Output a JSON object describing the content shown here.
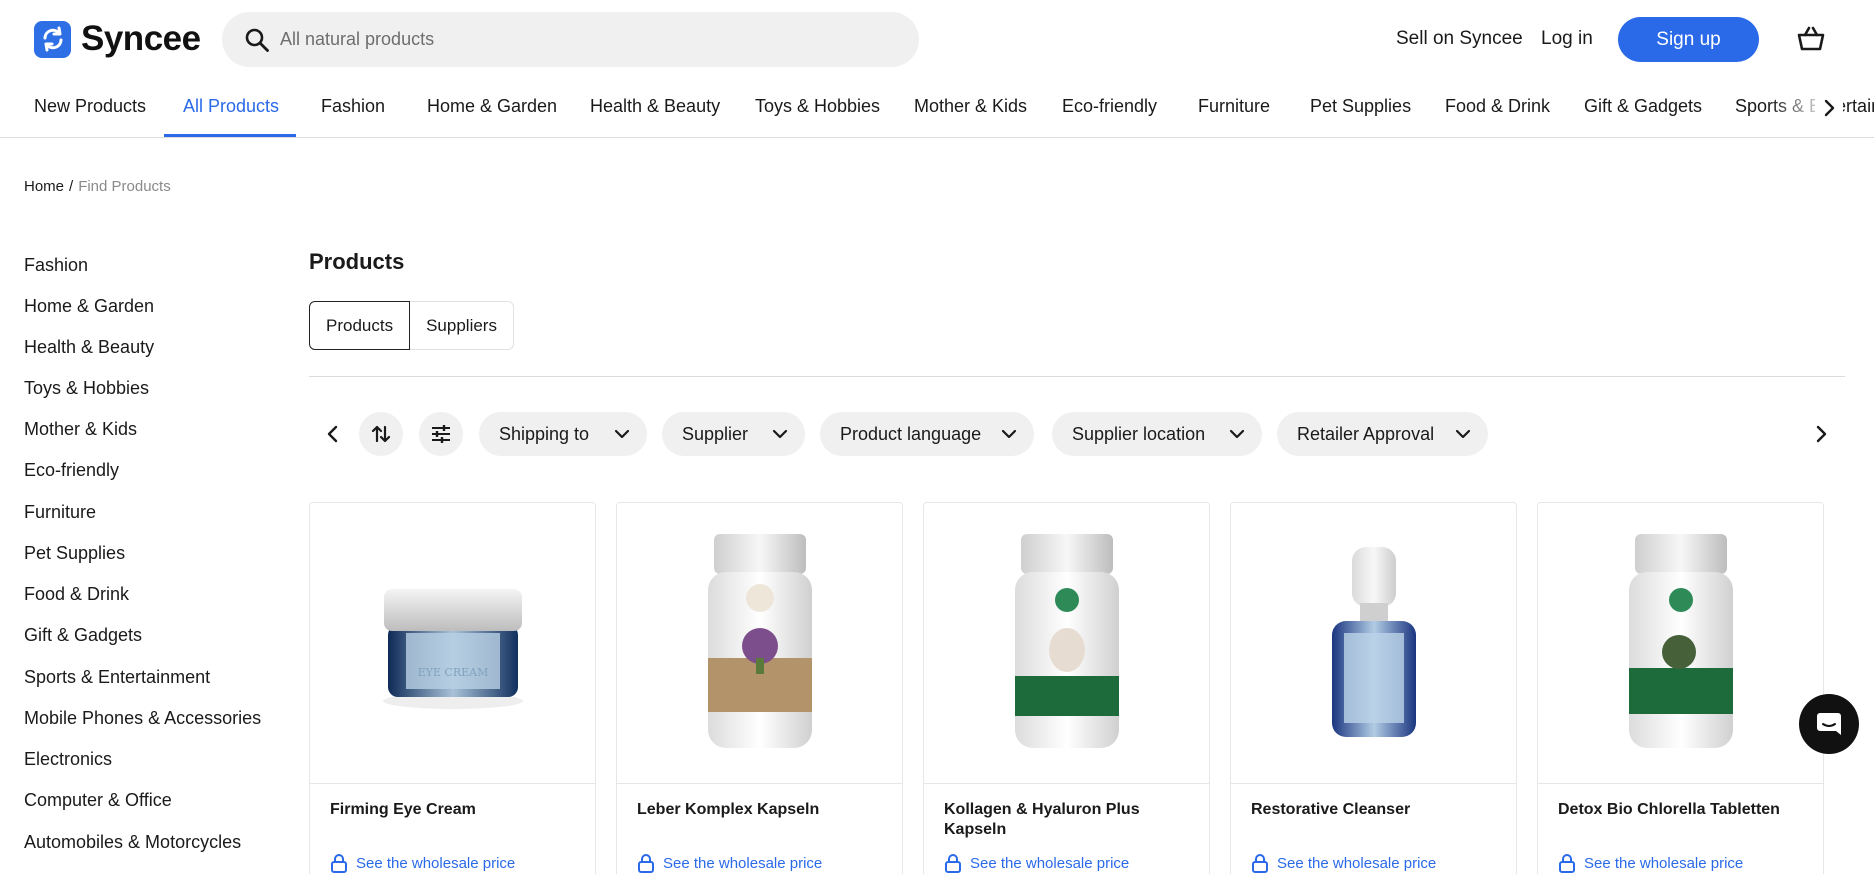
{
  "brand": {
    "name": "Syncee",
    "accent": "#2a6ae9"
  },
  "search": {
    "placeholder": "All natural products"
  },
  "header": {
    "sell": "Sell on Syncee",
    "login": "Log in",
    "signup": "Sign up",
    "cart_icon": "basket-icon"
  },
  "categories": [
    {
      "label": "New Products",
      "active": false
    },
    {
      "label": "All Products",
      "active": true
    },
    {
      "label": "Fashion",
      "active": false
    },
    {
      "label": "Home & Garden",
      "active": false
    },
    {
      "label": "Health & Beauty",
      "active": false
    },
    {
      "label": "Toys & Hobbies",
      "active": false
    },
    {
      "label": "Mother & Kids",
      "active": false
    },
    {
      "label": "Eco-friendly",
      "active": false
    },
    {
      "label": "Furniture",
      "active": false
    },
    {
      "label": "Pet Supplies",
      "active": false
    },
    {
      "label": "Food & Drink",
      "active": false
    },
    {
      "label": "Gift & Gadgets",
      "active": false
    },
    {
      "label": "Sports & Entertainment",
      "active": false
    }
  ],
  "breadcrumb": {
    "home": "Home",
    "separator": "/",
    "current": "Find Products"
  },
  "sidebar": {
    "items": [
      "Fashion",
      "Home & Garden",
      "Health & Beauty",
      "Toys & Hobbies",
      "Mother & Kids",
      "Eco-friendly",
      "Furniture",
      "Pet Supplies",
      "Food & Drink",
      "Gift & Gadgets",
      "Sports & Entertainment",
      "Mobile Phones & Accessories",
      "Electronics",
      "Computer & Office",
      "Automobiles & Motorcycles"
    ]
  },
  "main": {
    "title": "Products",
    "tabs": [
      {
        "label": "Products",
        "selected": true
      },
      {
        "label": "Suppliers",
        "selected": false
      }
    ]
  },
  "filters": [
    "Shipping to",
    "Supplier",
    "Product language",
    "Supplier location",
    "Retailer Approval"
  ],
  "products": [
    {
      "name": "Firming Eye Cream",
      "price_label": "See the wholesale price",
      "image": "cream-jar"
    },
    {
      "name": "Leber Komplex Kapseln",
      "price_label": "See the wholesale price",
      "image": "capsule-bottle-gold"
    },
    {
      "name": "Kollagen & Hyaluron Plus Kapseln",
      "price_label": "See the wholesale price",
      "image": "capsule-bottle-green"
    },
    {
      "name": "Restorative Cleanser",
      "price_label": "See the wholesale price",
      "image": "pump-bottle"
    },
    {
      "name": "Detox Bio Chlorella Tabletten",
      "price_label": "See the wholesale price",
      "image": "capsule-bottle-green"
    }
  ]
}
